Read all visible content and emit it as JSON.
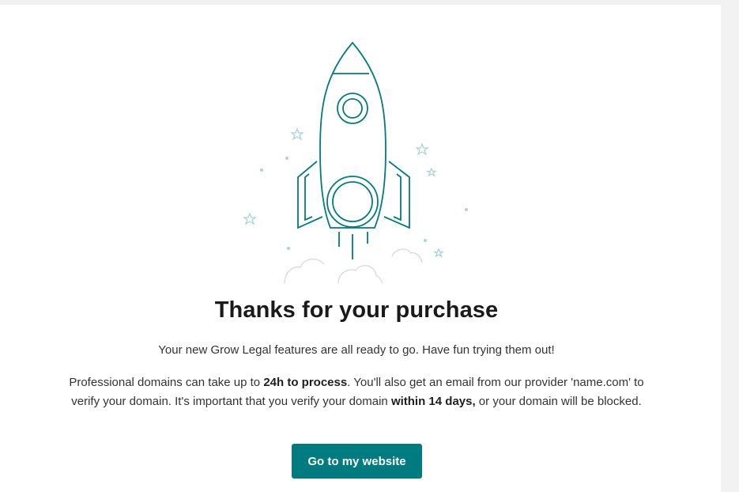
{
  "colors": {
    "accent": "#007b80",
    "star": "#a9d4d6",
    "cloud": "#d6d6d6"
  },
  "illustration": {
    "icon": "rocket-icon"
  },
  "confirmation": {
    "title": "Thanks for your purchase",
    "subtitle": "Your new Grow Legal features are all ready to go. Have fun trying them out!",
    "details": {
      "part1": "Professional domains can take up to ",
      "bold1": "24h to process",
      "part2": ". You'll also get an email from our provider 'name.com' to verify your domain. It's important that you verify your domain ",
      "bold2": "within 14 days,",
      "part3": " or your domain will be blocked."
    },
    "cta_label": "Go to my website"
  }
}
